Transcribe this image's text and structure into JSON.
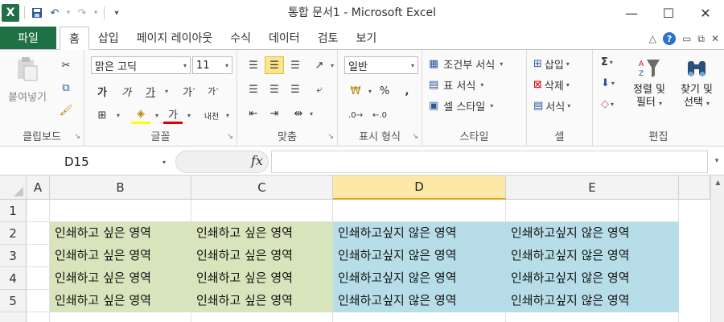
{
  "app": {
    "title": "통합 문서1 - Microsoft Excel",
    "logo_letter": "X"
  },
  "qat": {
    "save_icon": "save-icon",
    "undo_icon": "undo-icon",
    "redo_icon": "redo-icon"
  },
  "tabs": {
    "file": "파일",
    "items": [
      "홈",
      "삽입",
      "페이지 레이아웃",
      "수식",
      "데이터",
      "검토",
      "보기"
    ],
    "active": "홈"
  },
  "ribbon": {
    "clipboard": {
      "label": "클립보드",
      "paste": "붙여넣기"
    },
    "font": {
      "label": "글꼴",
      "name": "맑은 고딕",
      "size": "11",
      "bold": "가",
      "italic": "가",
      "underline": "가",
      "grow": "가",
      "shrink": "가",
      "color_letter": "가",
      "phonetic": "내천"
    },
    "alignment": {
      "label": "맞춤"
    },
    "number": {
      "label": "표시 형식",
      "format": "일반",
      "percent": "%",
      "comma": ","
    },
    "styles": {
      "label": "스타일",
      "conditional": "조건부 서식",
      "table": "표 서식",
      "cell": "셀 스타일"
    },
    "cells": {
      "label": "셀",
      "insert": "삽입",
      "delete": "삭제",
      "format": "서식"
    },
    "editing": {
      "label": "편집",
      "sort": "정렬 및",
      "sort2": "필터",
      "find": "찾기 및",
      "find2": "선택",
      "sigma": "Σ"
    }
  },
  "formula_bar": {
    "name_box": "D15",
    "fx": "fx",
    "content": ""
  },
  "sheet": {
    "columns": [
      "A",
      "B",
      "C",
      "D",
      "E"
    ],
    "selected_column": "D",
    "rows": [
      "1",
      "2",
      "3",
      "4",
      "5"
    ],
    "print_text": "인쇄하고 싶은 영역",
    "noprint_text": "인쇄하고싶지 않은 영역",
    "colors": {
      "print": "#d8e4bc",
      "noprint": "#b7dee8",
      "selected_header": "#fde8a8"
    }
  }
}
